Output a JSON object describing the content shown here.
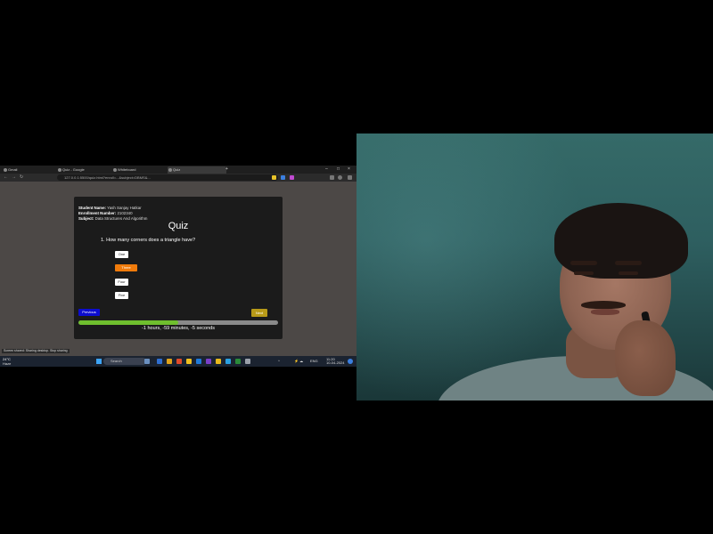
{
  "browser": {
    "tabs": [
      "Gmail",
      "Quiz - Google",
      "Whiteboard",
      "Quiz"
    ],
    "address": "127.0.0.1:5500/quiz.html?enroll=...&subject=DBMS&..."
  },
  "quiz": {
    "student_name_label": "Student Name:",
    "student_name": "Yash Sanjay Hatkar",
    "enrollment_label": "Enrollment Number:",
    "enrollment": "2102340",
    "subject_label": "Subject:",
    "subject": "Data Structures And Algorithm",
    "title": "Quiz",
    "question": "1. How many corners does a triangle have?",
    "options": [
      "One",
      "Three",
      "Four",
      "Five"
    ],
    "selected_option_index": 1,
    "previous_label": "Previous",
    "next_label": "Next",
    "progress": 0.5,
    "timer": "-1 hours, -59 minutes, -5 seconds"
  },
  "tooltip": "Screen shared: Sharing desktop. Stop sharing",
  "taskbar": {
    "weather_temp": "24°C",
    "weather_desc": "Haze",
    "search_placeholder": "Search",
    "clock_time": "11:20",
    "clock_date": "10-04-2024",
    "language": "ENG"
  },
  "colors": {
    "selected_option": "#f07b0b",
    "previous_button": "#0d0dcf",
    "next_button": "#b89a18",
    "progress_fill": "#6fbf2e",
    "card_bg": "#1b1b1b"
  }
}
